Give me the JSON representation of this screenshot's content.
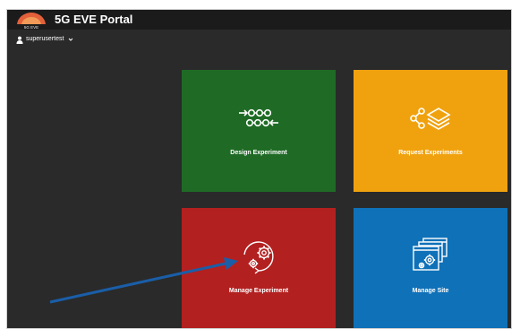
{
  "header": {
    "title": "5G EVE Portal",
    "logo_text": "5G EVE"
  },
  "user": {
    "name": "superusertest"
  },
  "tiles": [
    {
      "label": "Design Experiment",
      "color": "#1f6b26",
      "icon": "workflow-icon"
    },
    {
      "label": "Request Experiments",
      "color": "#f0a20e",
      "icon": "share-layers-icon"
    },
    {
      "label": "Manage Experiment",
      "color": "#b32020",
      "icon": "gears-cycle-icon"
    },
    {
      "label": "Manage Site",
      "color": "#0f71b8",
      "icon": "site-windows-gear-icon"
    }
  ],
  "annotation": {
    "icon": "blue-pointer-arrow",
    "color": "#1a5ea8"
  }
}
